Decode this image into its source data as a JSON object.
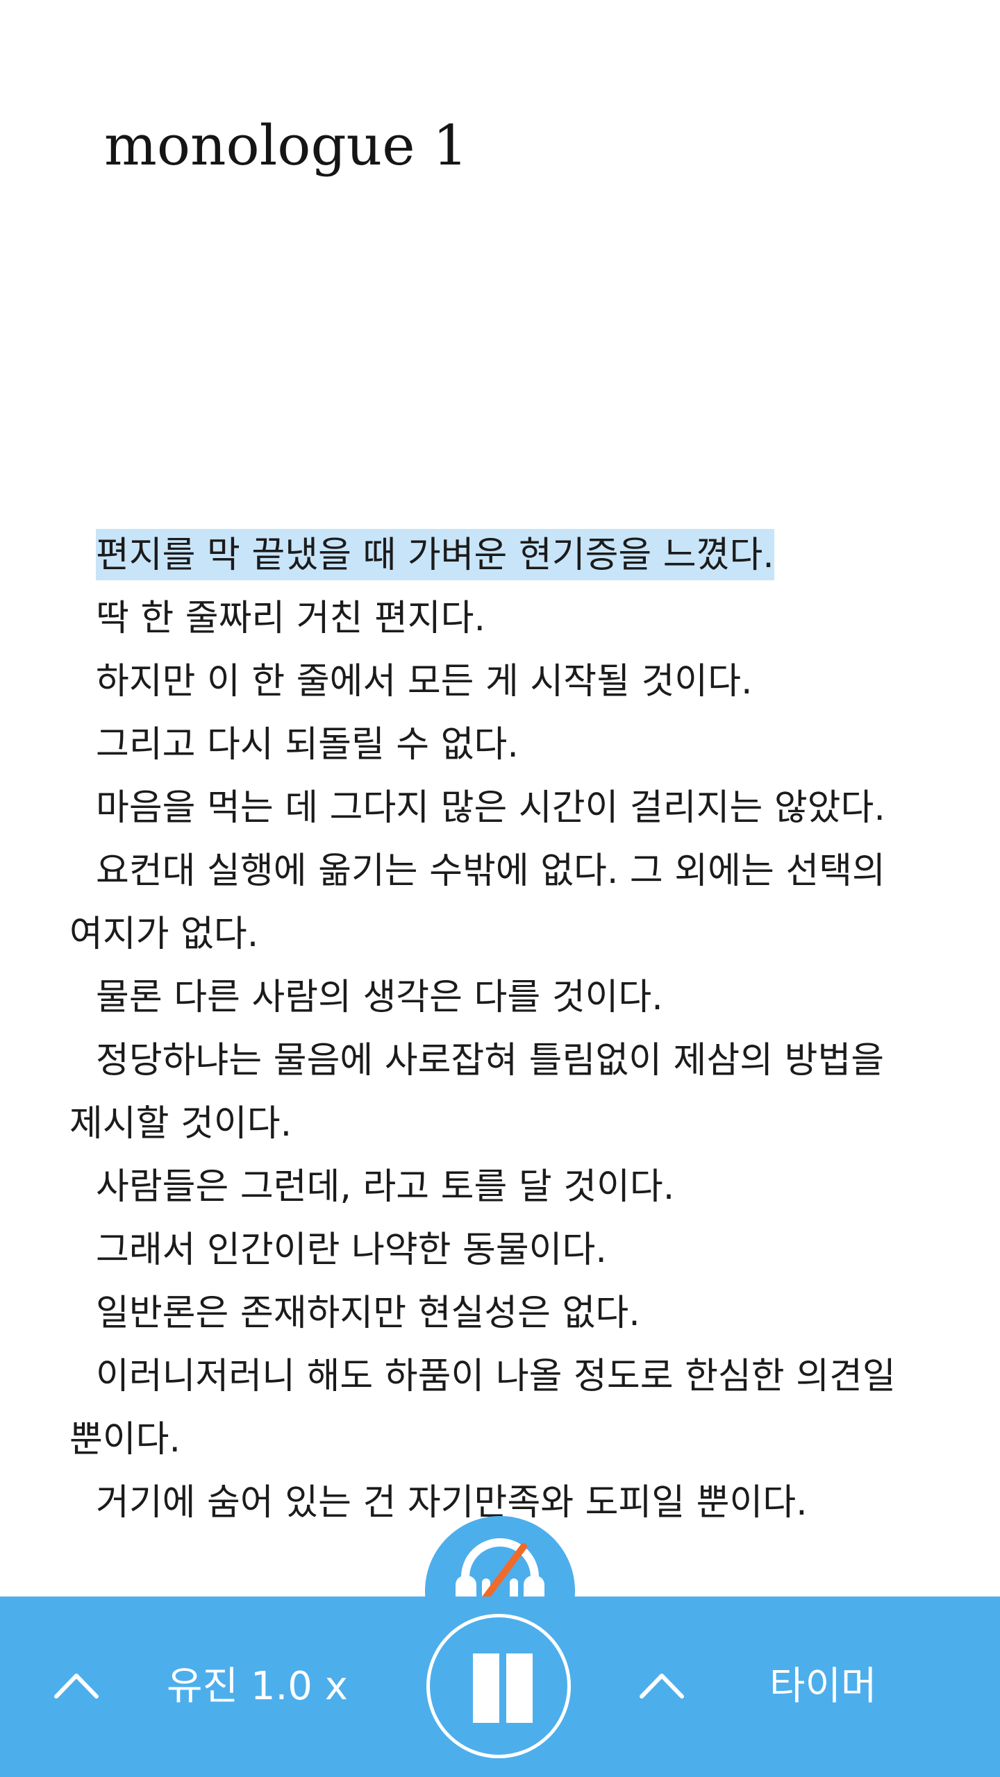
{
  "document": {
    "title": "monologue 1",
    "paragraphs": [
      "편지를 막 끝냈을 때 가벼운 현기증을 느꼈다.",
      "딱 한 줄짜리 거친 편지다.",
      "하지만 이 한 줄에서 모든 게 시작될 것이다.",
      "그리고 다시 되돌릴 수 없다.",
      "마음을 먹는 데 그다지 많은 시간이 걸리지는 않았다.",
      "요컨대 실행에 옮기는 수밖에 없다. 그 외에는 선택의 여지가 없다.",
      "물론 다른 사람의 생각은 다를 것이다.",
      "정당하냐는 물음에 사로잡혀 틀림없이 제삼의 방법을 제시할 것이다.",
      "사람들은 그런데, 라고 토를 달 것이다.",
      "그래서 인간이란 나약한 동물이다.",
      "일반론은 존재하지만 현실성은 없다.",
      "이러니저러니 해도 하품이 나올 정도로 한심한 의견일 뿐이다.",
      "거기에 숨어 있는 건 자기만족와 도피일 뿐이다."
    ],
    "highlighted_paragraph_index": 0
  },
  "player": {
    "voice_label": "유진 1.0 x",
    "timer_label": "타이머",
    "headphone_icon": "headphone-muted-icon",
    "pause_icon": "pause-icon",
    "chevron_icon": "chevron-up-icon",
    "colors": {
      "bar": "#4daeec",
      "highlight": "#c8e4f8",
      "mute_slash": "#f06a2a",
      "foreground": "#ffffff"
    }
  }
}
